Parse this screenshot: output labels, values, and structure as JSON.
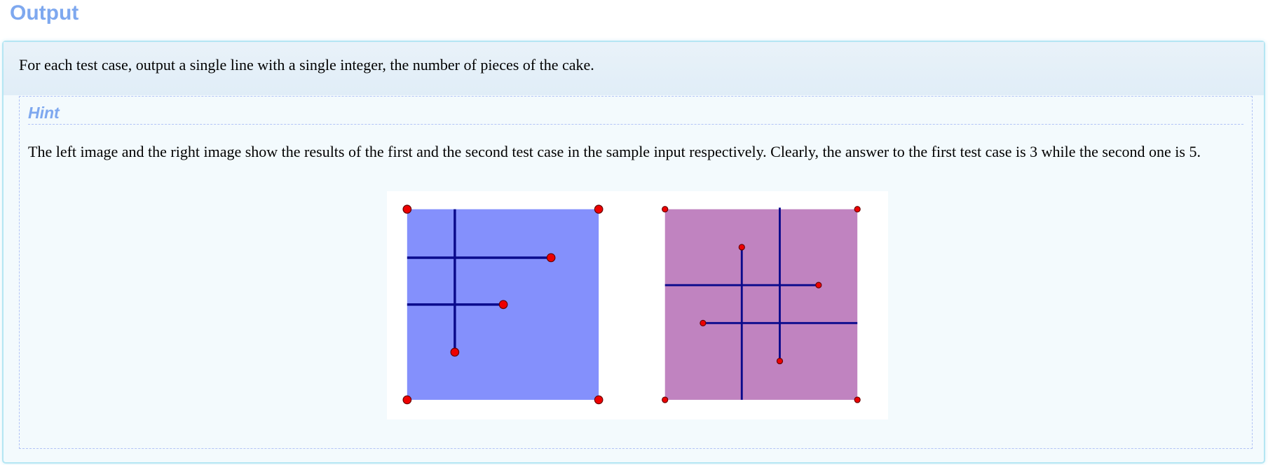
{
  "section": {
    "title": "Output"
  },
  "output": {
    "description": "For each test case, output a single line with a single integer, the number of pieces of the cake."
  },
  "hint": {
    "title": "Hint",
    "text": "The left image and the right image show the results of the first and the second test case in the sample input respectively. Clearly, the answer to the first test case is 3 while the second one is 5."
  },
  "figure": {
    "left_color": "#8490fc",
    "right_color": "#c083c0",
    "line_color": "#0a0a8c",
    "point_color": "#ee0000"
  }
}
